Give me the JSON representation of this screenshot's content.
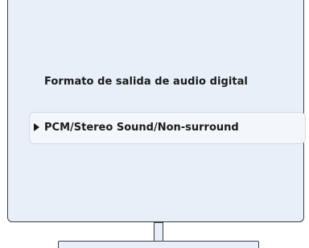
{
  "menu": {
    "title": "Formato de salida de audio digital",
    "selected_option": "PCM/Stereo Sound/Non-surround",
    "selected_indicator_icon": "triangle-right-icon"
  },
  "colors": {
    "screen_background": "#e9eff8",
    "option_background": "#f3f7fc",
    "outline": "#3c3f44",
    "text": "#1a1a1a"
  }
}
